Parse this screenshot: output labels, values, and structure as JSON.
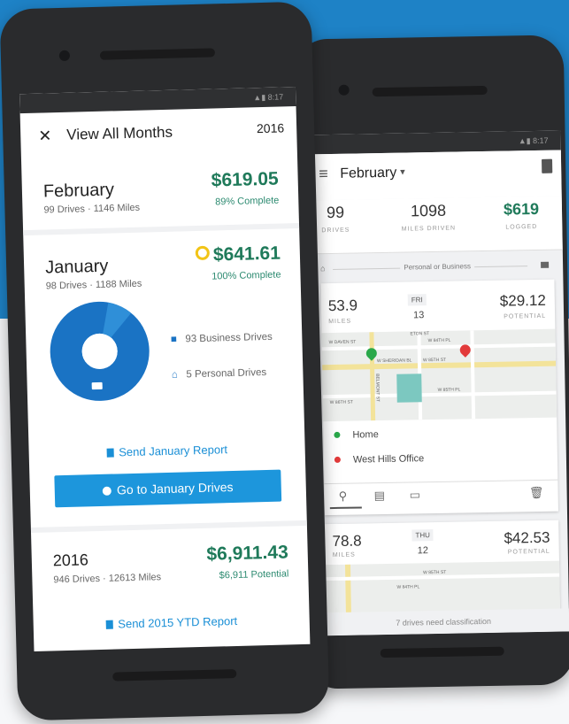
{
  "front": {
    "status": "▲▮ 8:17",
    "header": {
      "close_icon": "✕",
      "title": "View All Months",
      "year": "2016"
    },
    "february": {
      "name": "February",
      "summary": "99 Drives · 1146 Miles",
      "amount": "$619.05",
      "progress": "89% Complete"
    },
    "january": {
      "name": "January",
      "summary": "98 Drives · 1188 Miles",
      "amount": "$641.61",
      "progress": "100% Complete",
      "legend": [
        {
          "icon": "briefcase-icon",
          "label": "93 Business Drives"
        },
        {
          "icon": "home-icon",
          "label": "5 Personal Drives"
        }
      ],
      "donut": {
        "business": 93,
        "personal": 5
      },
      "send_report": "Send January Report",
      "cta": "Go to January Drives"
    },
    "year_summary": {
      "name": "2016",
      "summary": "946 Drives · 12613 Miles",
      "amount": "$6,911.43",
      "potential": "$6,911 Potential",
      "send_report": "Send 2015 YTD Report"
    }
  },
  "back": {
    "status": "▲▮ 8:17",
    "header": {
      "menu_icon": "≡",
      "month": "February",
      "caret": "▾"
    },
    "stats": [
      {
        "value": "99",
        "label": "DRIVES"
      },
      {
        "value": "1098",
        "label": "MILES DRIVEN"
      },
      {
        "value": "$619",
        "label": "LOGGED"
      }
    ],
    "classify_label": "Personal or Business",
    "drive1": {
      "miles": "53.9",
      "miles_label": "MILES",
      "day": "FRI",
      "date": "13",
      "amount": "$29.12",
      "amount_label": "POTENTIAL",
      "streets": [
        "W DAVEN ST",
        "W 84TH PL",
        "W SHERIDAN BL",
        "W 85TH ST",
        "ETON ST",
        "W 85TH PL",
        "BELMONT ST",
        "W 86TH ST"
      ],
      "origin": "Home",
      "destination": "West Hills Office"
    },
    "drive2": {
      "miles": "78.8",
      "miles_label": "MILES",
      "day": "THU",
      "date": "12",
      "amount": "$42.53",
      "amount_label": "POTENTIAL",
      "streets": [
        "W 85TH ST",
        "W 84TH PL"
      ]
    },
    "footer": "7 drives need classification"
  },
  "colors": {
    "brand_blue": "#1e82c6",
    "money_green": "#1f7a5a",
    "donut_blue": "#1a73c4",
    "pin_green": "#2aa84a",
    "pin_red": "#e23a3a"
  }
}
